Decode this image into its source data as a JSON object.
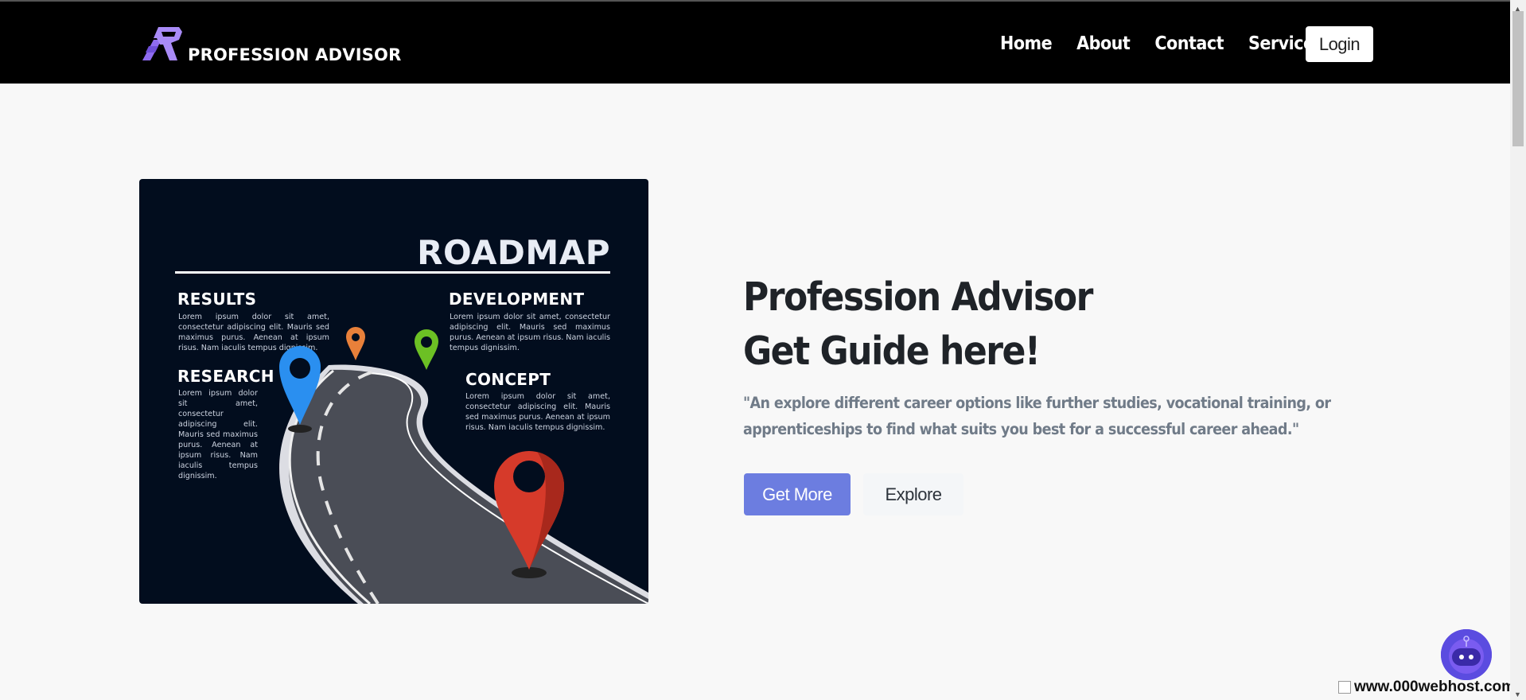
{
  "brand": {
    "name": "PROFESSION ADVISOR",
    "logo_icon": "profession-advisor-logo"
  },
  "nav": {
    "items": [
      {
        "label": "Home"
      },
      {
        "label": "About"
      },
      {
        "label": "Contact"
      },
      {
        "label": "Services"
      }
    ],
    "login_label": "Login"
  },
  "hero": {
    "title_line1": "Profession Advisor",
    "title_line2": "Get Guide here!",
    "description": "\"An explore different career options like further studies, vocational training, or apprenticeships to find what suits you best for a successful career ahead.\"",
    "primary_button": "Get More",
    "secondary_button": "Explore"
  },
  "roadmap_image": {
    "title": "ROADMAP",
    "sections": [
      {
        "heading": "RESULTS",
        "text": "Lorem ipsum dolor sit amet, consectetur adipiscing elit. Mauris sed maximus purus. Aenean at ipsum risus. Nam iaculis tempus dignissim."
      },
      {
        "heading": "DEVELOPMENT",
        "text": "Lorem ipsum dolor sit amet, consectetur adipiscing elit. Mauris sed maximus purus. Aenean at ipsum risus. Nam iaculis tempus dignissim."
      },
      {
        "heading": "RESEARCH",
        "text": "Lorem ipsum dolor sit amet, consectetur adipiscing elit. Mauris sed maximus purus. Aenean at ipsum risus. Nam iaculis tempus dignissim."
      },
      {
        "heading": "CONCEPT",
        "text": "Lorem ipsum dolor sit amet, consectetur adipiscing elit. Mauris sed maximus purus. Aenean at ipsum risus. Nam iaculis tempus dignissim."
      }
    ],
    "pin_colors": [
      "#2a8ff0",
      "#e8803a",
      "#6cc024",
      "#d63a2a"
    ]
  },
  "footer_badge": {
    "text": "www.000webhost.com"
  },
  "colors": {
    "navbar_bg": "#000000",
    "accent": "#6c7de0",
    "page_bg": "#f8f8f8",
    "chat_bubble": "#5b4ce0"
  }
}
